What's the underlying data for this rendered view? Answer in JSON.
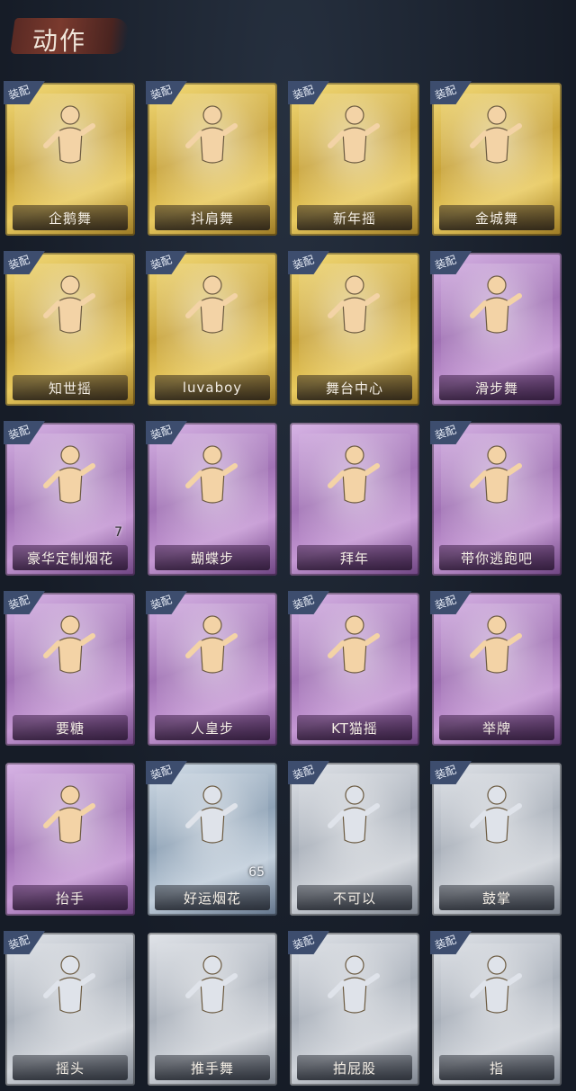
{
  "header": {
    "title": "动作"
  },
  "equip_tag": "装配",
  "cards": [
    {
      "label": "企鹅舞",
      "tier": "gold",
      "equipped": true,
      "icon": "penguin-dance-icon"
    },
    {
      "label": "抖肩舞",
      "tier": "gold",
      "equipped": true,
      "icon": "shoulder-shake-icon"
    },
    {
      "label": "新年摇",
      "tier": "gold",
      "equipped": true,
      "icon": "new-year-shake-icon"
    },
    {
      "label": "金城舞",
      "tier": "gold",
      "equipped": true,
      "icon": "jincheng-dance-icon"
    },
    {
      "label": "知世摇",
      "tier": "gold",
      "equipped": true,
      "icon": "zhishi-shake-icon"
    },
    {
      "label": "luvaboy",
      "tier": "gold",
      "equipped": true,
      "icon": "luvaboy-icon"
    },
    {
      "label": "舞台中心",
      "tier": "gold",
      "equipped": true,
      "icon": "stage-center-icon"
    },
    {
      "label": "滑步舞",
      "tier": "purple",
      "equipped": true,
      "icon": "slide-dance-icon"
    },
    {
      "label": "豪华定制烟花",
      "tier": "purple",
      "equipped": true,
      "icon": "fireworks-box-icon",
      "count": "7"
    },
    {
      "label": "蝴蝶步",
      "tier": "purple",
      "equipped": true,
      "icon": "butterfly-step-icon"
    },
    {
      "label": "拜年",
      "tier": "purple",
      "equipped": false,
      "icon": "new-year-greeting-icon"
    },
    {
      "label": "带你逃跑吧",
      "tier": "purple",
      "equipped": true,
      "icon": "run-away-icon"
    },
    {
      "label": "要糖",
      "tier": "purple",
      "equipped": true,
      "icon": "ask-candy-icon"
    },
    {
      "label": "人皇步",
      "tier": "purple",
      "equipped": true,
      "icon": "king-step-icon"
    },
    {
      "label": "KT猫摇",
      "tier": "purple",
      "equipped": true,
      "icon": "kt-cat-shake-icon"
    },
    {
      "label": "举牌",
      "tier": "purple",
      "equipped": true,
      "icon": "hold-sign-icon"
    },
    {
      "label": "抬手",
      "tier": "purple",
      "equipped": false,
      "icon": "raise-hand-icon"
    },
    {
      "label": "好运烟花",
      "tier": "blue",
      "equipped": true,
      "icon": "lucky-firework-icon",
      "count": "65"
    },
    {
      "label": "不可以",
      "tier": "grey",
      "equipped": true,
      "icon": "no-finger-icon"
    },
    {
      "label": "鼓掌",
      "tier": "grey",
      "equipped": true,
      "icon": "clap-icon"
    },
    {
      "label": "摇头",
      "tier": "grey",
      "equipped": true,
      "icon": "shake-head-icon"
    },
    {
      "label": "推手舞",
      "tier": "grey",
      "equipped": false,
      "icon": "push-hand-dance-icon"
    },
    {
      "label": "拍屁股",
      "tier": "grey",
      "equipped": true,
      "icon": "slap-butt-icon"
    },
    {
      "label": "指",
      "tier": "grey",
      "equipped": true,
      "icon": "point-icon"
    }
  ]
}
